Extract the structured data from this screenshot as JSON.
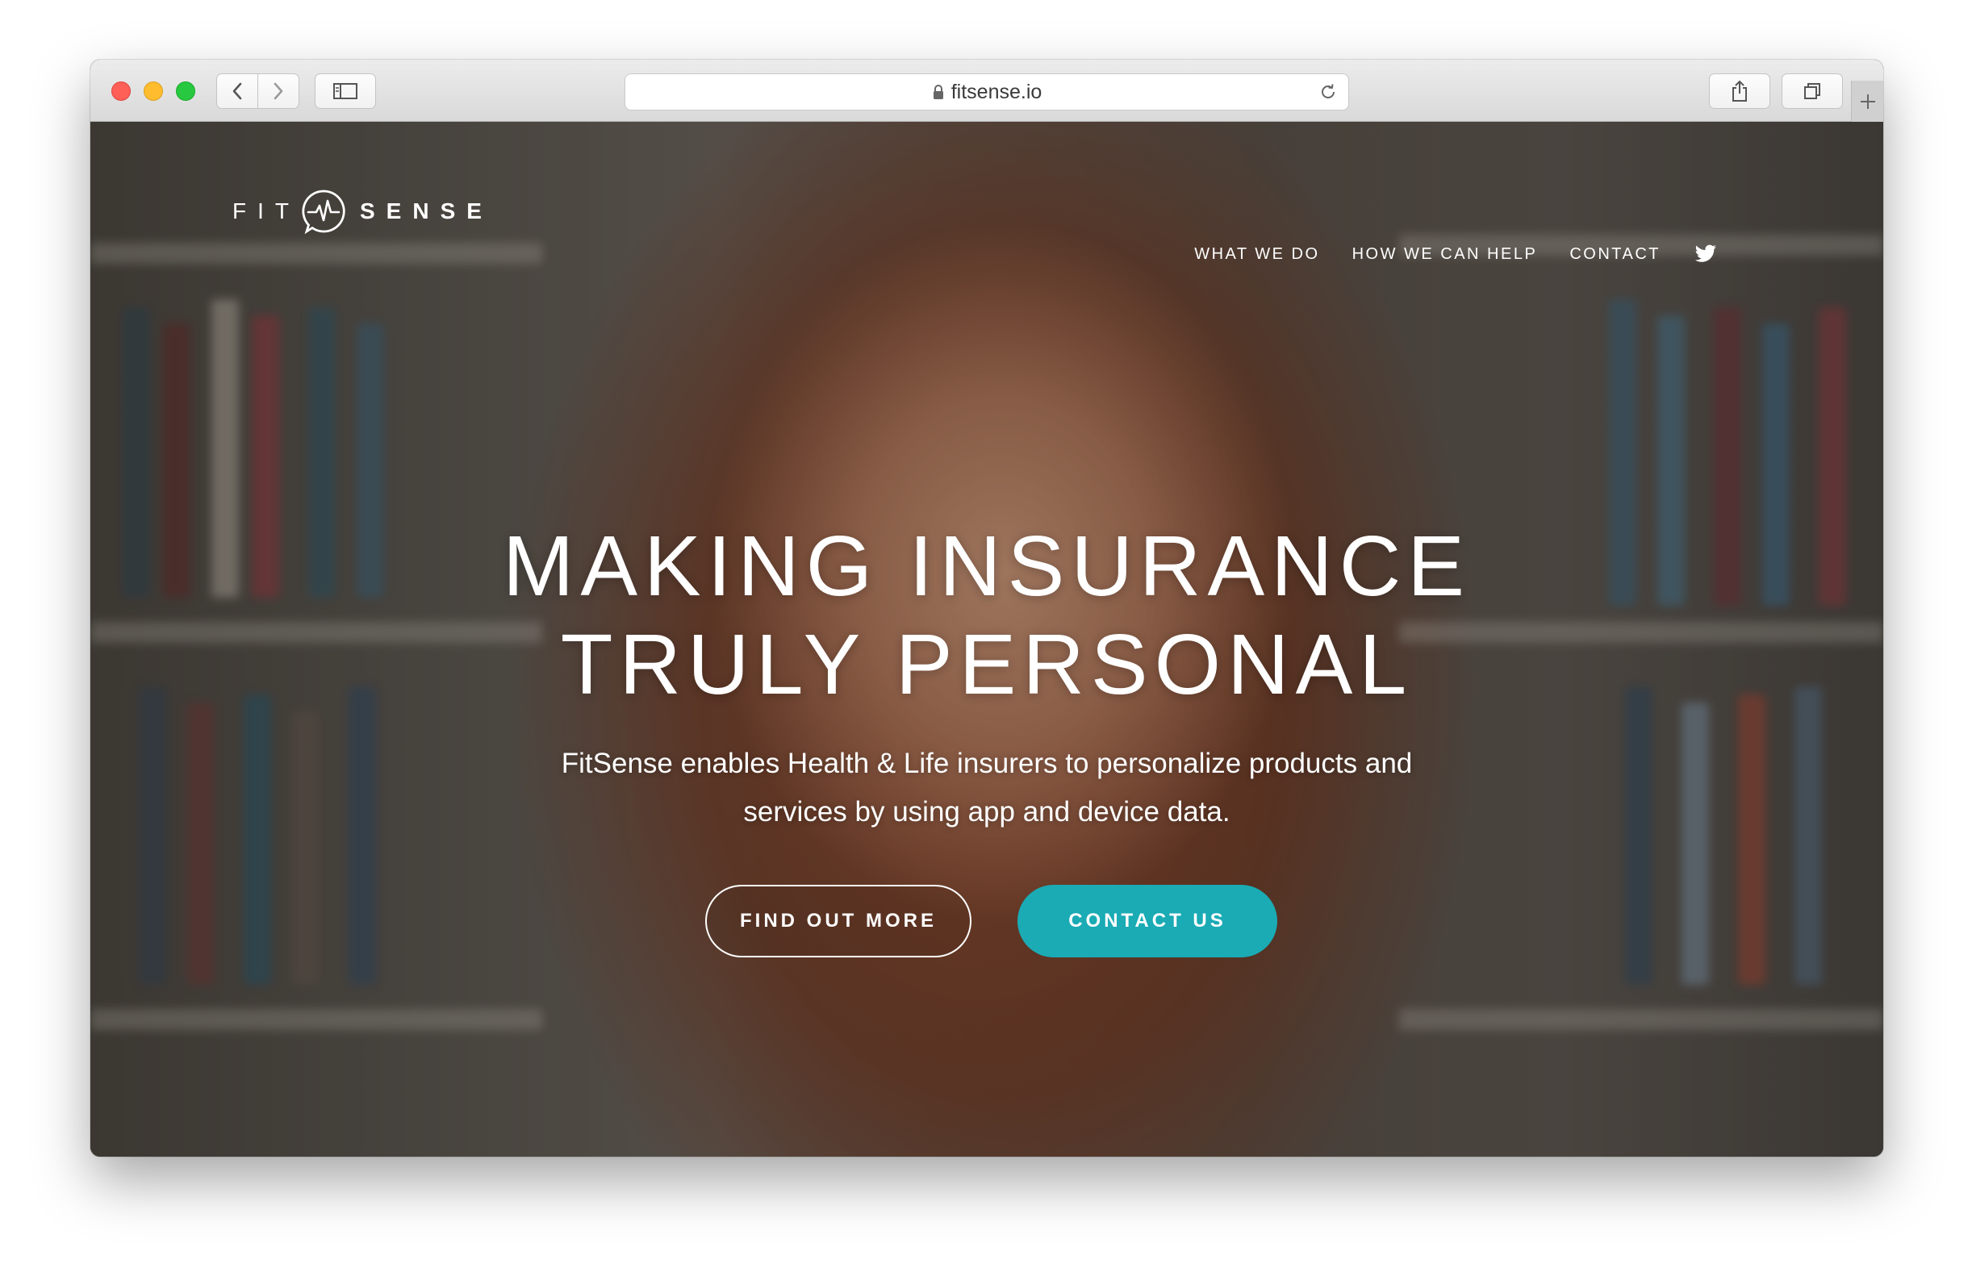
{
  "browser": {
    "url": "fitsense.io",
    "icons": {
      "back": "chevron-left-icon",
      "forward": "chevron-right-icon",
      "sidebar": "sidebar-icon",
      "lock": "lock-icon",
      "reload": "reload-icon",
      "share": "share-icon",
      "tabs": "tabs-overview-icon",
      "new_tab": "plus-icon"
    }
  },
  "site": {
    "logo": {
      "left": "FIT",
      "right": "SENSE",
      "icon": "heartbeat-icon"
    },
    "nav": [
      {
        "label": "WHAT WE DO"
      },
      {
        "label": "HOW WE CAN HELP"
      },
      {
        "label": "CONTACT"
      }
    ],
    "social_icon": "twitter-icon",
    "hero": {
      "headline_line1": "MAKING INSURANCE",
      "headline_line2": "TRULY PERSONAL",
      "subtext_line1": "FitSense enables Health & Life insurers to personalize products and",
      "subtext_line2": "services by using app and device data.",
      "primary_button": "CONTACT US",
      "secondary_button": "FIND OUT MORE"
    },
    "colors": {
      "accent": "#1aabb5",
      "text": "#ffffff"
    }
  }
}
